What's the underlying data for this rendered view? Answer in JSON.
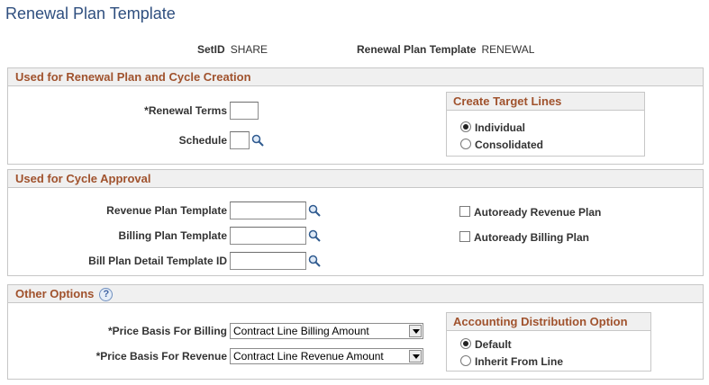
{
  "page": {
    "title": "Renewal Plan Template"
  },
  "keys": {
    "setid_label": "SetID",
    "setid_value": "SHARE",
    "template_label": "Renewal Plan Template",
    "template_value": "RENEWAL"
  },
  "renewal_section": {
    "header": "Used for Renewal Plan and Cycle Creation",
    "renewal_terms_label": "*Renewal Terms",
    "renewal_terms_value": "",
    "schedule_label": "Schedule",
    "schedule_value": "",
    "target_lines": {
      "header": "Create Target Lines",
      "options": [
        "Individual",
        "Consolidated"
      ],
      "selected": "Individual"
    }
  },
  "approval_section": {
    "header": "Used for Cycle Approval",
    "revenue_plan_label": "Revenue Plan Template",
    "revenue_plan_value": "",
    "billing_plan_label": "Billing Plan Template",
    "billing_plan_value": "",
    "bill_plan_detail_label": "Bill Plan Detail Template ID",
    "bill_plan_detail_value": "",
    "autoready_revenue_label": "Autoready Revenue Plan",
    "autoready_revenue_checked": false,
    "autoready_billing_label": "Autoready Billing Plan",
    "autoready_billing_checked": false
  },
  "other_section": {
    "header": "Other Options",
    "price_billing_label": "*Price Basis For Billing",
    "price_billing_value": "Contract Line Billing Amount",
    "price_revenue_label": "*Price Basis For Revenue",
    "price_revenue_value": "Contract Line Revenue Amount",
    "accounting": {
      "header": "Accounting Distribution Option",
      "options": [
        "Default",
        "Inherit From Line"
      ],
      "selected": "Default"
    }
  },
  "icons": {
    "lookup": "magnifier-icon",
    "help": "question-icon",
    "dropdown": "chevron-down-icon"
  },
  "colors": {
    "title": "#2f4f7f",
    "section_header_text": "#a0522d",
    "section_header_bg": "#f0f0f0"
  }
}
